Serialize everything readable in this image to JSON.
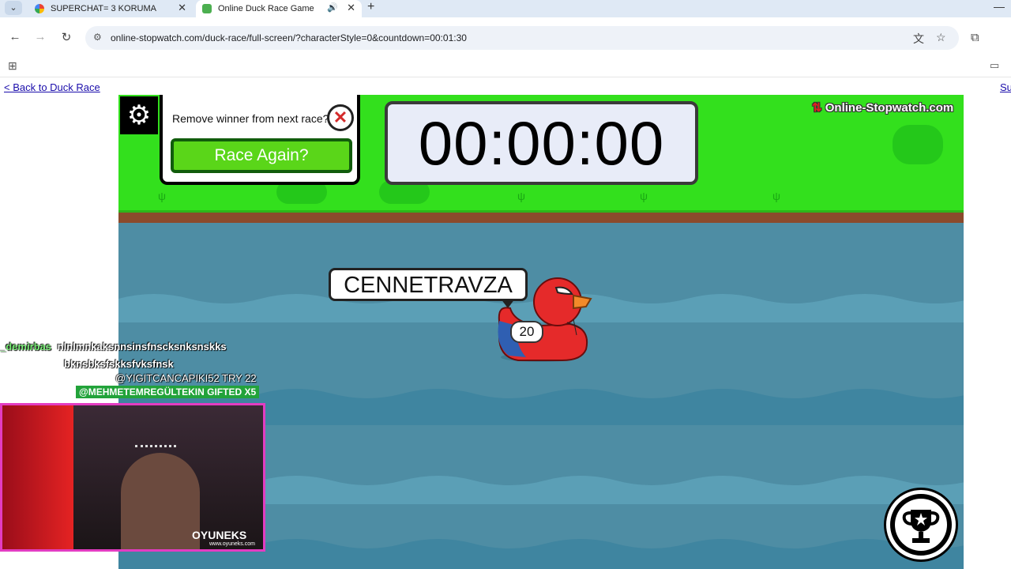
{
  "browser": {
    "tabs": [
      {
        "label": "SUPERCHAT= 3 KORUMA"
      },
      {
        "label": "Online Duck Race Game"
      }
    ],
    "url": "online-stopwatch.com/duck-race/full-screen/?characterStyle=0&countdown=00:01:30"
  },
  "page": {
    "back_link": "< Back to Duck Race",
    "right_link": "Su"
  },
  "game": {
    "winner_prompt": "Remove winner from next race?",
    "race_again_label": "Race Again?",
    "timer": "00:00:00",
    "brand": "Online-Stopwatch.com",
    "duck_name": "CENNETRAVZA",
    "duck_number": "20",
    "colors": {
      "grass": "#33e01d",
      "water": "#4e8da4",
      "race_button": "#5ad619",
      "duck": "#e52a2a"
    }
  },
  "overlay": {
    "chat": [
      {
        "user": "_demirbas",
        "text": "nlnlmnkaksnnsinsfnscksnksnskks"
      },
      {
        "user": "",
        "text": "bknsbksfskksfvksfnsk"
      },
      {
        "user": "",
        "text": "@YIGITCANCAPIKI52  TRY 22"
      }
    ],
    "gift_banner": "@MEHMETEMREGÜLTEKIN  GIFTED X5",
    "cam_logo": "OYUNEKS",
    "cam_url": "www.oyuneks.com"
  },
  "icons": {
    "settings": "gear-icon",
    "close": "close-icon",
    "trophy": "trophy-icon",
    "back": "back-arrow-icon",
    "forward": "forward-arrow-icon",
    "reload": "reload-icon"
  }
}
